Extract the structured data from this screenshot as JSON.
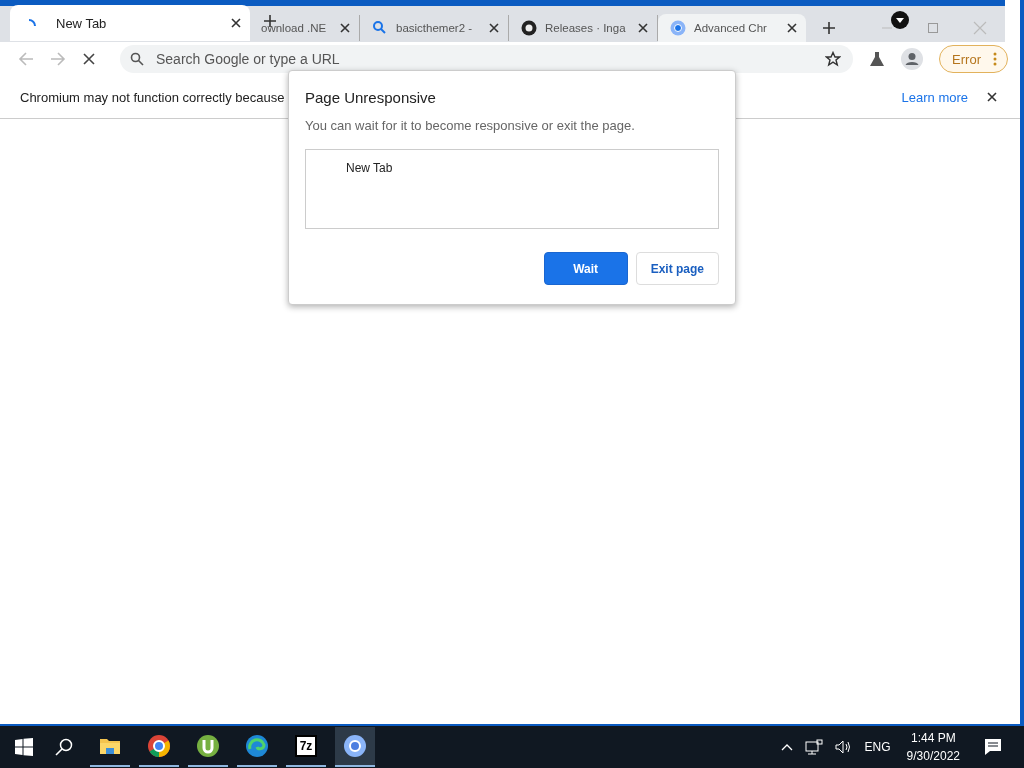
{
  "front_tab": {
    "title": "New Tab",
    "loading": true
  },
  "background_tabs": [
    {
      "title": "ownload .NE",
      "kind": "plain",
      "selected": false
    },
    {
      "title": "basicthemer2 -",
      "kind": "search",
      "selected": false
    },
    {
      "title": "Releases · Inga",
      "kind": "repository",
      "selected": false
    },
    {
      "title": "Advanced Chr",
      "kind": "browser",
      "selected": true
    }
  ],
  "toolbar": {
    "back_disabled": true,
    "forward_disabled": true,
    "address_placeholder": "Search Google or type a URL",
    "error_button": "Error"
  },
  "infobar": {
    "message": "Chromium may not function correctly because",
    "link": "Learn more"
  },
  "dialog": {
    "title": "Page Unresponsive",
    "message": "You can wait for it to become responsive or exit the page.",
    "pages": [
      "New Tab"
    ],
    "buttons": [
      {
        "label": "Wait",
        "kind": "primary"
      },
      {
        "label": "Exit page",
        "kind": "secondary"
      }
    ]
  },
  "taskbar": {
    "apps": [
      {
        "kind": "explorer",
        "active": false
      },
      {
        "kind": "chrome",
        "active": false
      },
      {
        "kind": "utorrent",
        "active": false
      },
      {
        "kind": "edge",
        "active": false
      },
      {
        "kind": "sevenzip",
        "label": "7z",
        "active": false
      },
      {
        "kind": "chromium",
        "active": true
      }
    ],
    "language": "ENG",
    "time": "1:44 PM",
    "date": "9/30/2022"
  }
}
